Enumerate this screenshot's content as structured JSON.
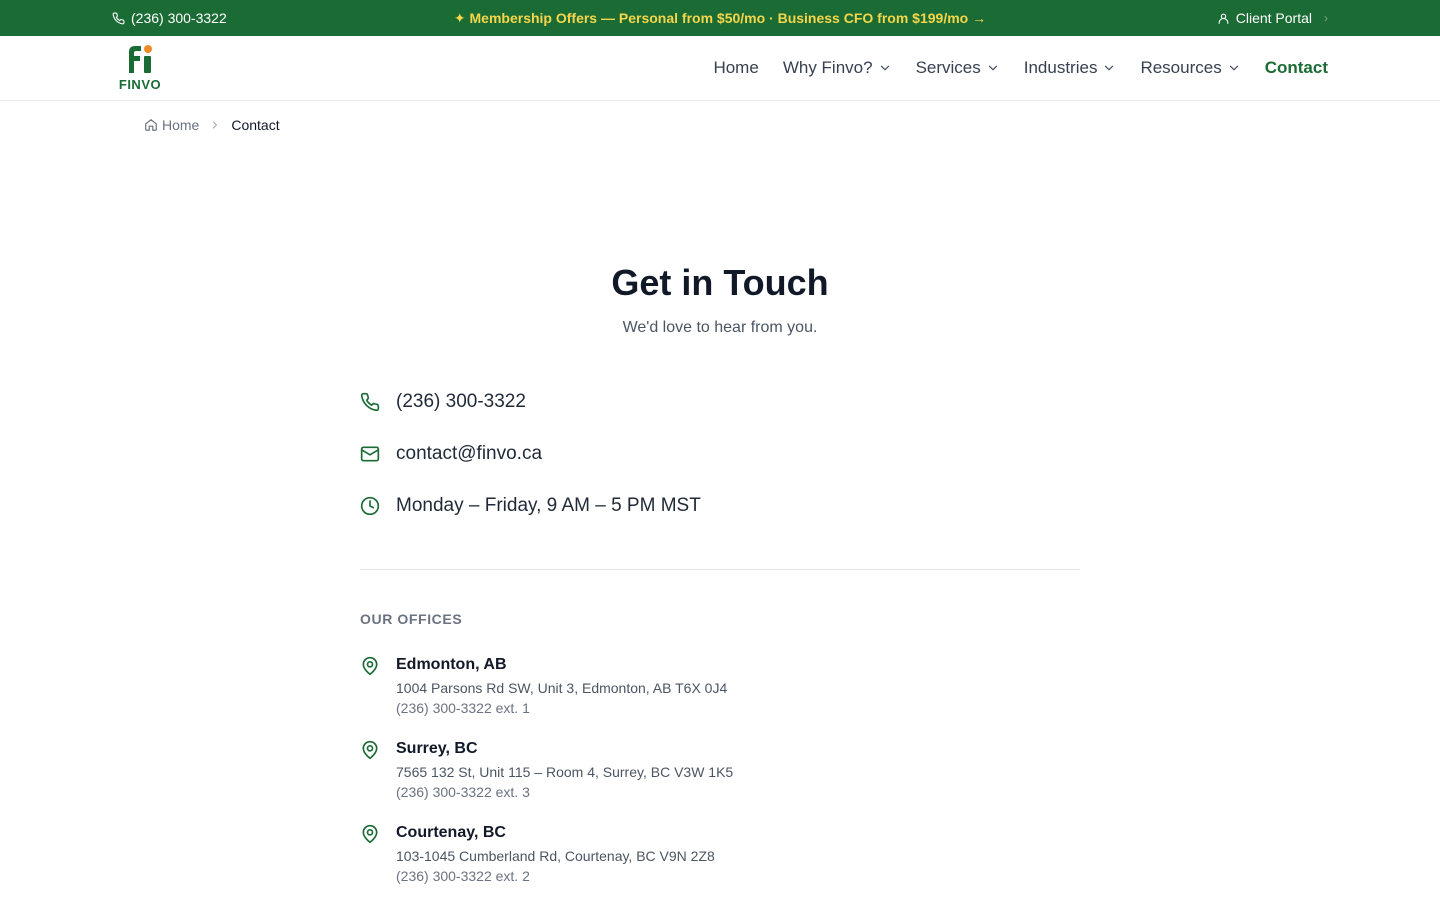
{
  "topbar": {
    "phone": "(236) 300-3322",
    "promo": "✦ Membership Offers — Personal from $50/mo · Business CFO from $199/mo →",
    "client_portal": "Client Portal"
  },
  "logo": {
    "text": "FINVO"
  },
  "nav": {
    "items": [
      {
        "label": "Home"
      },
      {
        "label": "Why Finvo?"
      },
      {
        "label": "Services"
      },
      {
        "label": "Industries"
      },
      {
        "label": "Resources"
      },
      {
        "label": "Contact"
      }
    ]
  },
  "breadcrumb": {
    "home": "Home",
    "current": "Contact"
  },
  "hero": {
    "title": "Get in Touch",
    "subtitle": "We'd love to hear from you."
  },
  "contact": {
    "phone": "(236) 300-3322",
    "email": "contact@finvo.ca",
    "hours": "Monday – Friday, 9 AM – 5 PM MST"
  },
  "offices": {
    "label": "OUR OFFICES",
    "items": [
      {
        "name": "Edmonton, AB",
        "address": "1004 Parsons Rd SW, Unit 3, Edmonton, AB T6X 0J4",
        "phone": "(236) 300-3322 ext. 1"
      },
      {
        "name": "Surrey, BC",
        "address": "7565 132 St, Unit 115 – Room 4, Surrey, BC V3W 1K5",
        "phone": "(236) 300-3322 ext. 3"
      },
      {
        "name": "Courtenay, BC",
        "address": "103-1045 Cumberland Rd, Courtenay, BC V9N 2Z8",
        "phone": "(236) 300-3322 ext. 2"
      }
    ]
  },
  "colors": {
    "brand_green": "#1b6b35",
    "promo_yellow": "#f5d64a",
    "logo_orange": "#f08a24"
  }
}
